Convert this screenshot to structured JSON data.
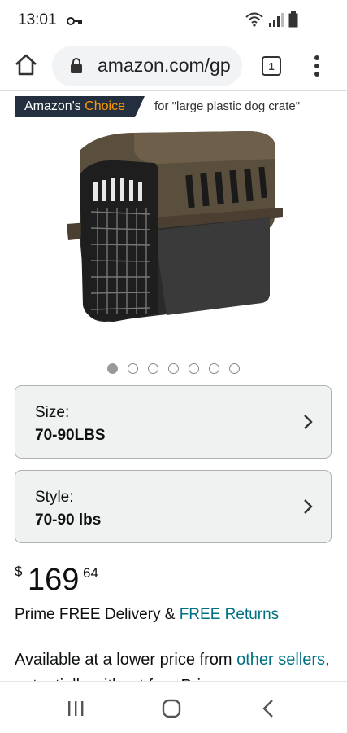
{
  "status_bar": {
    "time": "13:01",
    "icons": [
      "key-icon",
      "wifi-icon",
      "signal-icon",
      "battery-icon"
    ]
  },
  "browser": {
    "url": "amazon.com/gp",
    "tab_count": "1",
    "icons": [
      "home-icon",
      "lock-icon",
      "more-vert-icon"
    ]
  },
  "badge": {
    "prefix": "Amazon's",
    "highlight": "Choice",
    "for_text": "for \"large plastic dog crate\"",
    "colors": {
      "background": "#232f3e",
      "highlight": "#ff9900"
    }
  },
  "carousel": {
    "dot_count": 7,
    "active_index": 0
  },
  "selectors": [
    {
      "label": "Size:",
      "value": "70-90LBS"
    },
    {
      "label": "Style:",
      "value": "70-90 lbs"
    }
  ],
  "price": {
    "symbol": "$",
    "whole": "169",
    "fraction": "64"
  },
  "delivery": {
    "prefix": "Prime FREE Delivery & ",
    "link": "FREE Returns",
    "link_color": "#007185"
  },
  "availability": {
    "prefix": "Available at a lower price from ",
    "link": "other sellers",
    "suffix": ", potentially without free Prime"
  },
  "nav": {
    "icons": [
      "recents-icon",
      "home-circle-icon",
      "back-icon"
    ]
  }
}
